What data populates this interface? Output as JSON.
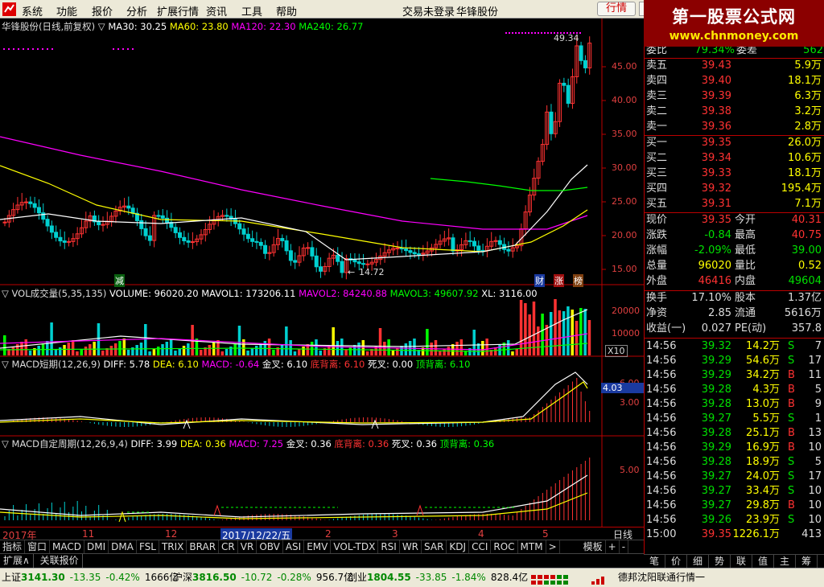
{
  "menu": {
    "items": [
      "系统",
      "功能",
      "报价",
      "分析",
      "扩展行情",
      "资讯",
      "工具",
      "帮助"
    ],
    "login_status": "交易未登录",
    "stock_name": "华锋股份",
    "quote_button": "行情"
  },
  "watermark": {
    "title": "第一股票公式网",
    "url": "www.chnmoney.com"
  },
  "price_panel": {
    "title": "华锋股份(日线,前复权)",
    "indicators": [
      {
        "label": "MA30: 30.25",
        "color": "#ffffff"
      },
      {
        "label": "MA60: 23.80",
        "color": "#ffff00"
      },
      {
        "label": "MA120: 22.30",
        "color": "#ff00ff"
      },
      {
        "label": "MA240: 26.77",
        "color": "#00ff00"
      }
    ],
    "y_ticks": [
      "45.00",
      "40.00",
      "35.00",
      "30.00",
      "25.00",
      "20.00",
      "15.00"
    ],
    "high_label": "49.34",
    "low_label": "14.72",
    "markers": [
      "减",
      "财",
      "涨",
      "榜"
    ]
  },
  "vol_panel": {
    "title": "VOL成交量(5,35,135)",
    "values": [
      {
        "label": "VOLUME: 96020.20",
        "color": "#ffffff"
      },
      {
        "label": "MAVOL1: 173206.11",
        "color": "#ffffff"
      },
      {
        "label": "MAVOL2: 84240.88",
        "color": "#ff00ff"
      },
      {
        "label": "MAVOL3: 49607.92",
        "color": "#00ff00"
      },
      {
        "label": "XL: 3116.00",
        "color": "#ffffff"
      }
    ],
    "y_ticks": [
      "20000",
      "10000"
    ],
    "unit": "X10"
  },
  "macd_panel": {
    "title": "MACD短期(12,26,9)",
    "values": [
      {
        "label": "DIFF: 5.78",
        "color": "#ffffff"
      },
      {
        "label": "DEA: 6.10",
        "color": "#ffff00"
      },
      {
        "label": "MACD: -0.64",
        "color": "#ff00ff"
      },
      {
        "label": "金叉: 6.10",
        "color": "#ffffff"
      },
      {
        "label": "底背离: 6.10",
        "color": "#ff3232"
      },
      {
        "label": "死叉: 0.00",
        "color": "#ffffff"
      },
      {
        "label": "顶背离: 6.10",
        "color": "#00ff00"
      }
    ],
    "y_ticks": [
      "6.00",
      "3.00"
    ],
    "cursor_value": "4.03"
  },
  "macd2_panel": {
    "title": "MACD自定周期(12,26,9,4)",
    "values": [
      {
        "label": "DIFF: 3.99",
        "color": "#ffffff"
      },
      {
        "label": "DEA: 0.36",
        "color": "#ffff00"
      },
      {
        "label": "MACD: 7.25",
        "color": "#ff00ff"
      },
      {
        "label": "金叉: 0.36",
        "color": "#ffffff"
      },
      {
        "label": "底背离: 0.36",
        "color": "#ff3232"
      },
      {
        "label": "死叉: 0.36",
        "color": "#ffffff"
      },
      {
        "label": "顶背离: 0.36",
        "color": "#00ff00"
      }
    ],
    "y_ticks": [
      "5.00"
    ]
  },
  "x_axis": {
    "labels": [
      "2017年",
      "11",
      "12",
      "2017/12/22/五",
      "2",
      "3",
      "4",
      "5"
    ],
    "timeframe": "日线"
  },
  "indicator_tabs": [
    "指标",
    "窗口",
    "MACD",
    "DMI",
    "DMA",
    "FSL",
    "TRIX",
    "BRAR",
    "CR",
    "VR",
    "OBV",
    "ASI",
    "EMV",
    "VOL-TDX",
    "RSI",
    "WR",
    "SAR",
    "KDJ",
    "CCI",
    "ROC",
    "MTM",
    ">",
    "模板",
    "+",
    "-"
  ],
  "ext_tabs": [
    "扩展∧",
    "关联报价"
  ],
  "order_book": {
    "header": {
      "label1": "委比",
      "val1": "79.34%",
      "label2": "委差",
      "val2": "562"
    },
    "asks": [
      {
        "label": "卖五",
        "price": "39.43",
        "vol": "5.9万"
      },
      {
        "label": "卖四",
        "price": "39.40",
        "vol": "18.1万"
      },
      {
        "label": "卖三",
        "price": "39.39",
        "vol": "6.3万"
      },
      {
        "label": "卖二",
        "price": "39.38",
        "vol": "3.2万"
      },
      {
        "label": "卖一",
        "price": "39.36",
        "vol": "2.8万"
      }
    ],
    "bids": [
      {
        "label": "买一",
        "price": "39.35",
        "vol": "26.0万"
      },
      {
        "label": "买二",
        "price": "39.34",
        "vol": "10.6万"
      },
      {
        "label": "买三",
        "price": "39.33",
        "vol": "18.1万"
      },
      {
        "label": "买四",
        "price": "39.32",
        "vol": "195.4万"
      },
      {
        "label": "买五",
        "price": "39.31",
        "vol": "7.1万"
      }
    ]
  },
  "quote_stats": [
    {
      "l1": "现价",
      "v1": "39.35",
      "c1": "up",
      "l2": "今开",
      "v2": "40.31",
      "c2": "up"
    },
    {
      "l1": "涨跌",
      "v1": "-0.84",
      "c1": "dn",
      "l2": "最高",
      "v2": "40.75",
      "c2": "up"
    },
    {
      "l1": "涨幅",
      "v1": "-2.09%",
      "c1": "dn",
      "l2": "最低",
      "v2": "39.00",
      "c2": "dn"
    },
    {
      "l1": "总量",
      "v1": "96020",
      "c1": "yl",
      "l2": "量比",
      "v2": "0.52",
      "c2": "yl"
    },
    {
      "l1": "外盘",
      "v1": "46416",
      "c1": "up",
      "l2": "内盘",
      "v2": "49604",
      "c2": "dn"
    }
  ],
  "fundamentals": [
    {
      "l1": "换手",
      "v1": "17.10%",
      "l2": "股本",
      "v2": "1.37亿"
    },
    {
      "l1": "净资",
      "v1": "2.85",
      "l2": "流通",
      "v2": "5616万"
    },
    {
      "l1": "收益(一)",
      "v1": "0.027",
      "l2": "PE(动)",
      "v2": "357.8"
    }
  ],
  "ticks": [
    {
      "time": "14:56",
      "price": "39.32",
      "vol": "14.2万",
      "bs": "S",
      "n": "7"
    },
    {
      "time": "14:56",
      "price": "39.29",
      "vol": "54.6万",
      "bs": "S",
      "n": "17"
    },
    {
      "time": "14:56",
      "price": "39.29",
      "vol": "34.2万",
      "bs": "B",
      "n": "11"
    },
    {
      "time": "14:56",
      "price": "39.28",
      "vol": "4.3万",
      "bs": "B",
      "n": "5"
    },
    {
      "time": "14:56",
      "price": "39.28",
      "vol": "13.0万",
      "bs": "B",
      "n": "9"
    },
    {
      "time": "14:56",
      "price": "39.27",
      "vol": "5.5万",
      "bs": "S",
      "n": "1"
    },
    {
      "time": "14:56",
      "price": "39.28",
      "vol": "25.1万",
      "bs": "B",
      "n": "13"
    },
    {
      "time": "14:56",
      "price": "39.29",
      "vol": "16.9万",
      "bs": "B",
      "n": "10"
    },
    {
      "time": "14:56",
      "price": "39.28",
      "vol": "18.9万",
      "bs": "S",
      "n": "5"
    },
    {
      "time": "14:56",
      "price": "39.27",
      "vol": "24.0万",
      "bs": "S",
      "n": "17"
    },
    {
      "time": "14:56",
      "price": "39.27",
      "vol": "33.4万",
      "bs": "S",
      "n": "10"
    },
    {
      "time": "14:56",
      "price": "39.27",
      "vol": "29.8万",
      "bs": "B",
      "n": "10"
    },
    {
      "time": "14:56",
      "price": "39.26",
      "vol": "23.9万",
      "bs": "S",
      "n": "10"
    },
    {
      "time": "15:00",
      "price": "39.35",
      "vol": "1226.1万",
      "bs": "",
      "n": "413"
    }
  ],
  "right_tabs": [
    "笔",
    "价",
    "细",
    "势",
    "联",
    "值",
    "主",
    "筹"
  ],
  "status_bar": [
    {
      "name": "上证",
      "price": "3141.30",
      "chg": "-13.35",
      "pct": "-0.42%",
      "amt": "1666亿"
    },
    {
      "name": "沪深",
      "price": "3816.50",
      "chg": "-10.72",
      "pct": "-0.28%",
      "amt": "956.7亿"
    },
    {
      "name": "创业",
      "price": "1804.55",
      "chg": "-33.85",
      "pct": "-1.84%",
      "amt": "828.4亿"
    }
  ],
  "status_server": "德邦沈阳联通行情一"
}
